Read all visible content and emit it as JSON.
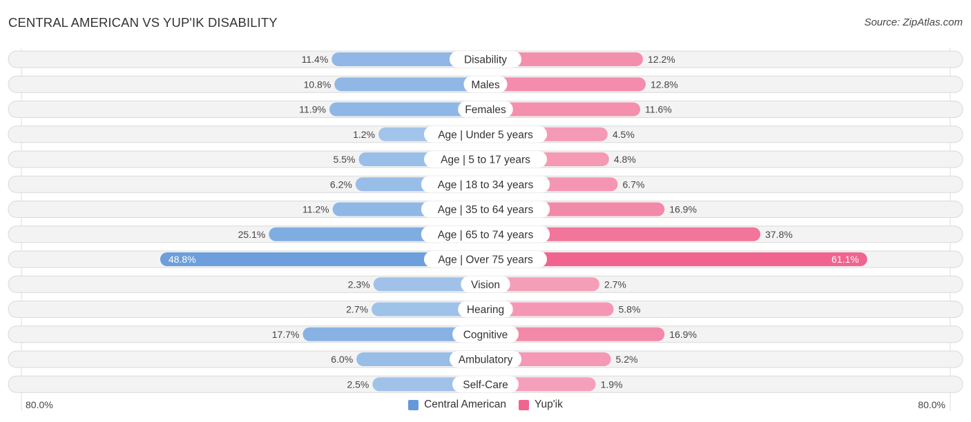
{
  "title": "CENTRAL AMERICAN VS YUP'IK DISABILITY",
  "source": "Source: ZipAtlas.com",
  "axis": {
    "left_label": "80.0%",
    "right_label": "80.0%"
  },
  "legend": [
    {
      "name": "Central American",
      "color": "#6399d9"
    },
    {
      "name": "Yup'ik",
      "color": "#f0648f"
    }
  ],
  "chart_data": {
    "type": "bar",
    "orientation": "diverging-horizontal",
    "title": "CENTRAL AMERICAN VS YUP'IK DISABILITY",
    "xlim": [
      -80,
      80
    ],
    "x_tick_labels": [
      "80.0%",
      "80.0%"
    ],
    "legend_position": "bottom-center",
    "categories": [
      "Disability",
      "Males",
      "Females",
      "Age | Under 5 years",
      "Age | 5 to 17 years",
      "Age | 18 to 34 years",
      "Age | 35 to 64 years",
      "Age | 65 to 74 years",
      "Age | Over 75 years",
      "Vision",
      "Hearing",
      "Cognitive",
      "Ambulatory",
      "Self-Care"
    ],
    "series": [
      {
        "name": "Central American",
        "side": "left",
        "color_light": "#aac9ec",
        "color_dark": "#6399d9",
        "values": [
          11.4,
          10.8,
          11.9,
          1.2,
          5.5,
          6.2,
          11.2,
          25.1,
          48.8,
          2.3,
          2.7,
          17.7,
          6.0,
          2.5
        ],
        "labels": [
          "11.4%",
          "10.8%",
          "11.9%",
          "1.2%",
          "5.5%",
          "6.2%",
          "11.2%",
          "25.1%",
          "48.8%",
          "2.3%",
          "2.7%",
          "17.7%",
          "6.0%",
          "2.5%"
        ]
      },
      {
        "name": "Yup'ik",
        "side": "right",
        "color_light": "#f6a8c0",
        "color_dark": "#f0648f",
        "values": [
          12.2,
          12.8,
          11.6,
          4.5,
          4.8,
          6.7,
          16.9,
          37.8,
          61.1,
          2.7,
          5.8,
          16.9,
          5.2,
          1.9
        ],
        "labels": [
          "12.2%",
          "12.8%",
          "11.6%",
          "4.5%",
          "4.8%",
          "6.7%",
          "16.9%",
          "37.8%",
          "61.1%",
          "2.7%",
          "5.8%",
          "16.9%",
          "5.2%",
          "1.9%"
        ]
      }
    ]
  }
}
